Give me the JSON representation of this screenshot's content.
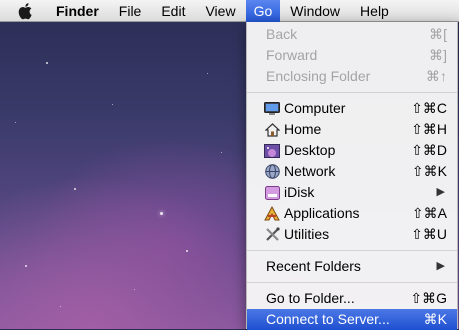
{
  "menubar": {
    "app_name": "Finder",
    "items": [
      "File",
      "Edit",
      "View",
      "Go",
      "Window",
      "Help"
    ],
    "active": "Go",
    "apple_icon": "apple-logo-icon"
  },
  "go_menu": {
    "group1": [
      {
        "label": "Back",
        "shortcut": "⌘[",
        "enabled": false
      },
      {
        "label": "Forward",
        "shortcut": "⌘]",
        "enabled": false
      },
      {
        "label": "Enclosing Folder",
        "shortcut": "⌘↑",
        "enabled": false
      }
    ],
    "group2": [
      {
        "label": "Computer",
        "shortcut": "⇧⌘C",
        "icon": "computer-icon"
      },
      {
        "label": "Home",
        "shortcut": "⇧⌘H",
        "icon": "home-icon"
      },
      {
        "label": "Desktop",
        "shortcut": "⇧⌘D",
        "icon": "desktop-icon"
      },
      {
        "label": "Network",
        "shortcut": "⇧⌘K",
        "icon": "network-icon"
      },
      {
        "label": "iDisk",
        "shortcut": "",
        "submenu": true,
        "icon": "idisk-icon"
      },
      {
        "label": "Applications",
        "shortcut": "⇧⌘A",
        "icon": "applications-icon"
      },
      {
        "label": "Utilities",
        "shortcut": "⇧⌘U",
        "icon": "utilities-icon"
      }
    ],
    "group3": [
      {
        "label": "Recent Folders",
        "submenu": true
      }
    ],
    "group4": [
      {
        "label": "Go to Folder...",
        "shortcut": "⇧⌘G"
      },
      {
        "label": "Connect to Server...",
        "shortcut": "⌘K",
        "highlighted": true
      }
    ]
  },
  "colors": {
    "highlight": "#2457d6",
    "disabled_text": "#a4a4a4",
    "menubar_bg": "#e6e6e6"
  }
}
